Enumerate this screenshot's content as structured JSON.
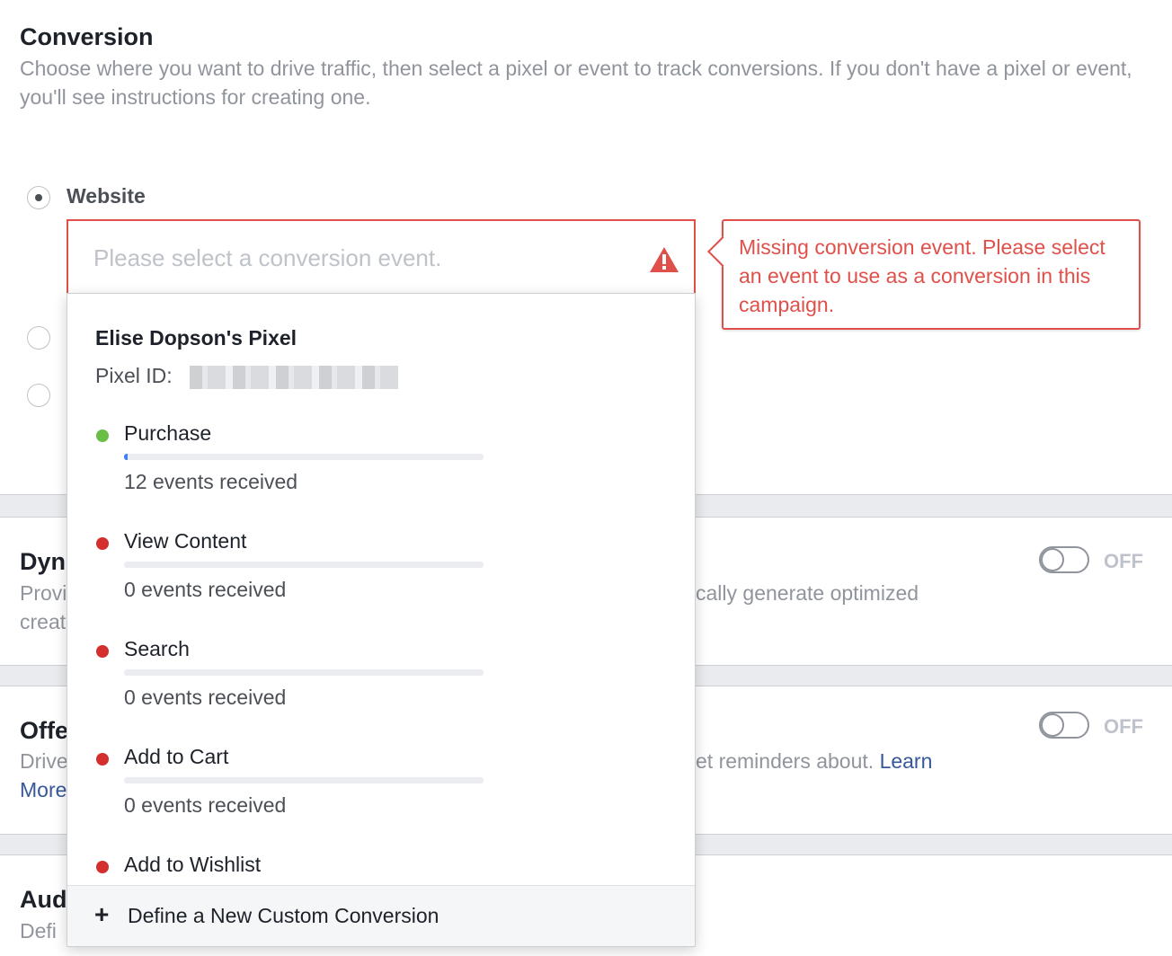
{
  "conversion": {
    "title": "Conversion",
    "description": "Choose where you want to drive traffic, then select a pixel or event to track conversions. If you don't have a pixel or event, you'll see instructions for creating one.",
    "website_label": "Website",
    "event_placeholder": "Please select a conversion event.",
    "error_message": "Missing conversion event. Please select an event to use as a conversion in this campaign."
  },
  "dynamic_creative": {
    "title_visible": "Dyn",
    "desc_line1_left": "Provi",
    "desc_line1_right": "cally generate optimized",
    "desc_line2_left": "creat",
    "toggle_label": "OFF"
  },
  "offer": {
    "title_visible": "Offe",
    "desc_line1_left": "Drive",
    "desc_line1_right": "et reminders about.",
    "learn_link": "Learn",
    "desc_line2_link": "More",
    "toggle_label": "OFF"
  },
  "audience": {
    "title_visible": "Aud",
    "desc_visible": "Defi"
  },
  "dropdown": {
    "pixel_name": "Elise Dopson's Pixel",
    "pixel_id_label": "Pixel ID:",
    "events": [
      {
        "name": "Purchase",
        "count": "12 events received",
        "status_color": "#6bbe45",
        "fill_percent": 1
      },
      {
        "name": "View Content",
        "count": "0 events received",
        "status_color": "#d32f2f",
        "fill_percent": 0
      },
      {
        "name": "Search",
        "count": "0 events received",
        "status_color": "#d32f2f",
        "fill_percent": 0
      },
      {
        "name": "Add to Cart",
        "count": "0 events received",
        "status_color": "#d32f2f",
        "fill_percent": 0
      },
      {
        "name": "Add to Wishlist",
        "count": "",
        "status_color": "#d32f2f",
        "fill_percent": 0
      }
    ],
    "footer_label": "Define a New Custom Conversion",
    "footer_icon": "plus-icon"
  },
  "colors": {
    "error": "#e0504a",
    "link": "#365899",
    "success": "#6bbe45",
    "progress": "#4080ff"
  }
}
